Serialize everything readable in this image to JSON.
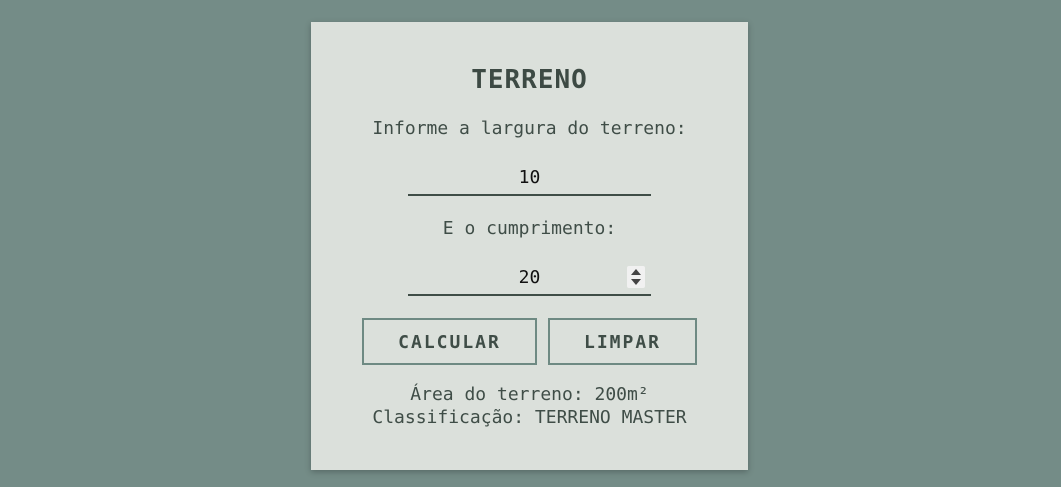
{
  "form": {
    "title": "TERRENO",
    "width_label": "Informe a largura do terreno:",
    "width_value": "10",
    "length_label": "E o cumprimento:",
    "length_value": "20",
    "calculate_label": "CALCULAR",
    "clear_label": "LIMPAR"
  },
  "result": {
    "area_text": "Área do terreno: 200m²",
    "classification_text": "Classificação: TERRENO MASTER"
  },
  "icons": {
    "spinner": "spinner-icon"
  },
  "colors": {
    "background": "#748c87",
    "card": "#dbe0db",
    "text": "#3f4d47",
    "button_border": "#6e8a83"
  }
}
